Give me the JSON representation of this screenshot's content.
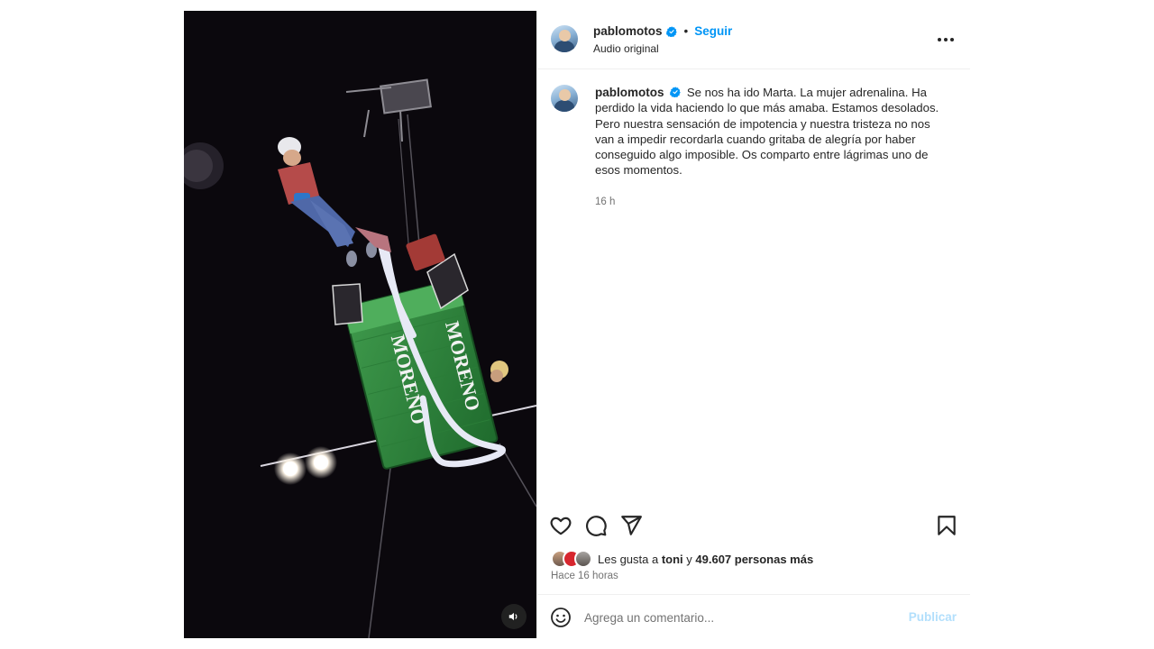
{
  "colors": {
    "accent": "#0095f6",
    "publish_disabled": "#b2dffc",
    "muted_text": "#737373",
    "text": "#262626",
    "divider": "#efefef"
  },
  "media": {
    "box_text_1": "MORENO",
    "box_text_2": "MORENO",
    "mute_icon": "speaker-icon"
  },
  "header": {
    "username": "pablomotos",
    "separator": "•",
    "follow_label": "Seguir",
    "audio_label": "Audio original",
    "verified_icon": "verified-badge-icon",
    "more_icon": "more-options-icon"
  },
  "caption": {
    "username": "pablomotos",
    "text": "Se nos ha ido Marta. La mujer adrenalina. Ha perdido la vida haciendo lo que más amaba. Estamos desolados. Pero nuestra sensación de impotencia y nuestra tristeza no nos van a impedir recordarla cuando gritaba de alegría por haber conseguido algo imposible. Os comparto entre lágrimas uno de esos momentos.",
    "time": "16 h"
  },
  "actions": {
    "like_icon": "heart-icon",
    "comment_icon": "comment-icon",
    "share_icon": "share-icon",
    "save_icon": "bookmark-icon"
  },
  "likes": {
    "prefix": "Les gusta a ",
    "friend": "toni",
    "connector": " y ",
    "others": "49.607 personas más"
  },
  "posted_ago": "Hace 16 horas",
  "comment": {
    "placeholder": "Agrega un comentario...",
    "publish_label": "Publicar",
    "emoji_icon": "emoji-icon"
  }
}
